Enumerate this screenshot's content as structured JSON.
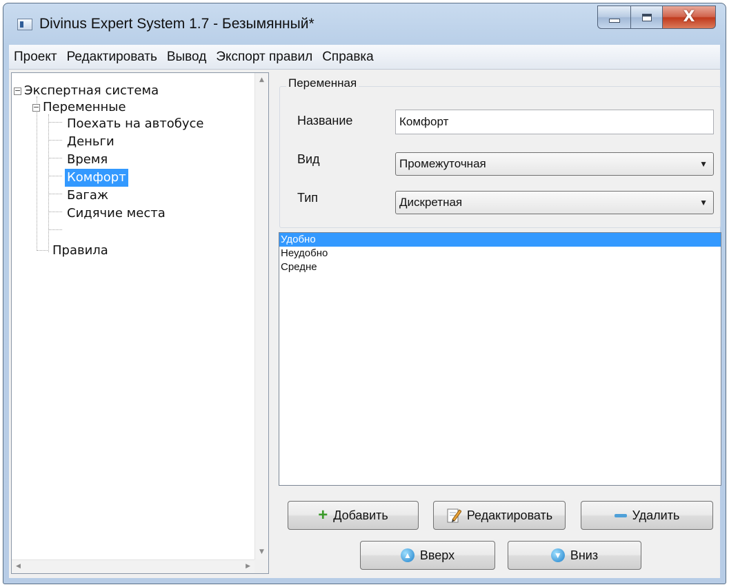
{
  "window": {
    "title": "Divinus Expert System 1.7 - Безымянный*",
    "close_glyph": "X"
  },
  "menu": [
    "Проект",
    "Редактировать",
    "Вывод",
    "Экспорт правил",
    "Справка"
  ],
  "tree": {
    "root": "Экспертная система",
    "variables_node": "Переменные",
    "variables": [
      "Поехать на автобусе",
      "Деньги",
      "Время",
      "Комфорт",
      "Багаж",
      "Сидячие места"
    ],
    "selected_index": 3,
    "rules_node": "Правила",
    "expand_glyph": "−"
  },
  "variable_panel": {
    "group_title": "Переменная",
    "name_label": "Название",
    "name_value": "Комфорт",
    "kind_label": "Вид",
    "kind_value": "Промежуточная",
    "type_label": "Тип",
    "type_value": "Дискретная"
  },
  "values_list": {
    "items": [
      "Удобно",
      "Неудобно",
      "Средне"
    ],
    "selected_index": 0
  },
  "buttons": {
    "add": "Добавить",
    "edit": "Редактировать",
    "delete": "Удалить",
    "up": "Вверх",
    "down": "Вниз"
  },
  "colors": {
    "selection": "#3399ff",
    "close_button": "#c0391d"
  }
}
